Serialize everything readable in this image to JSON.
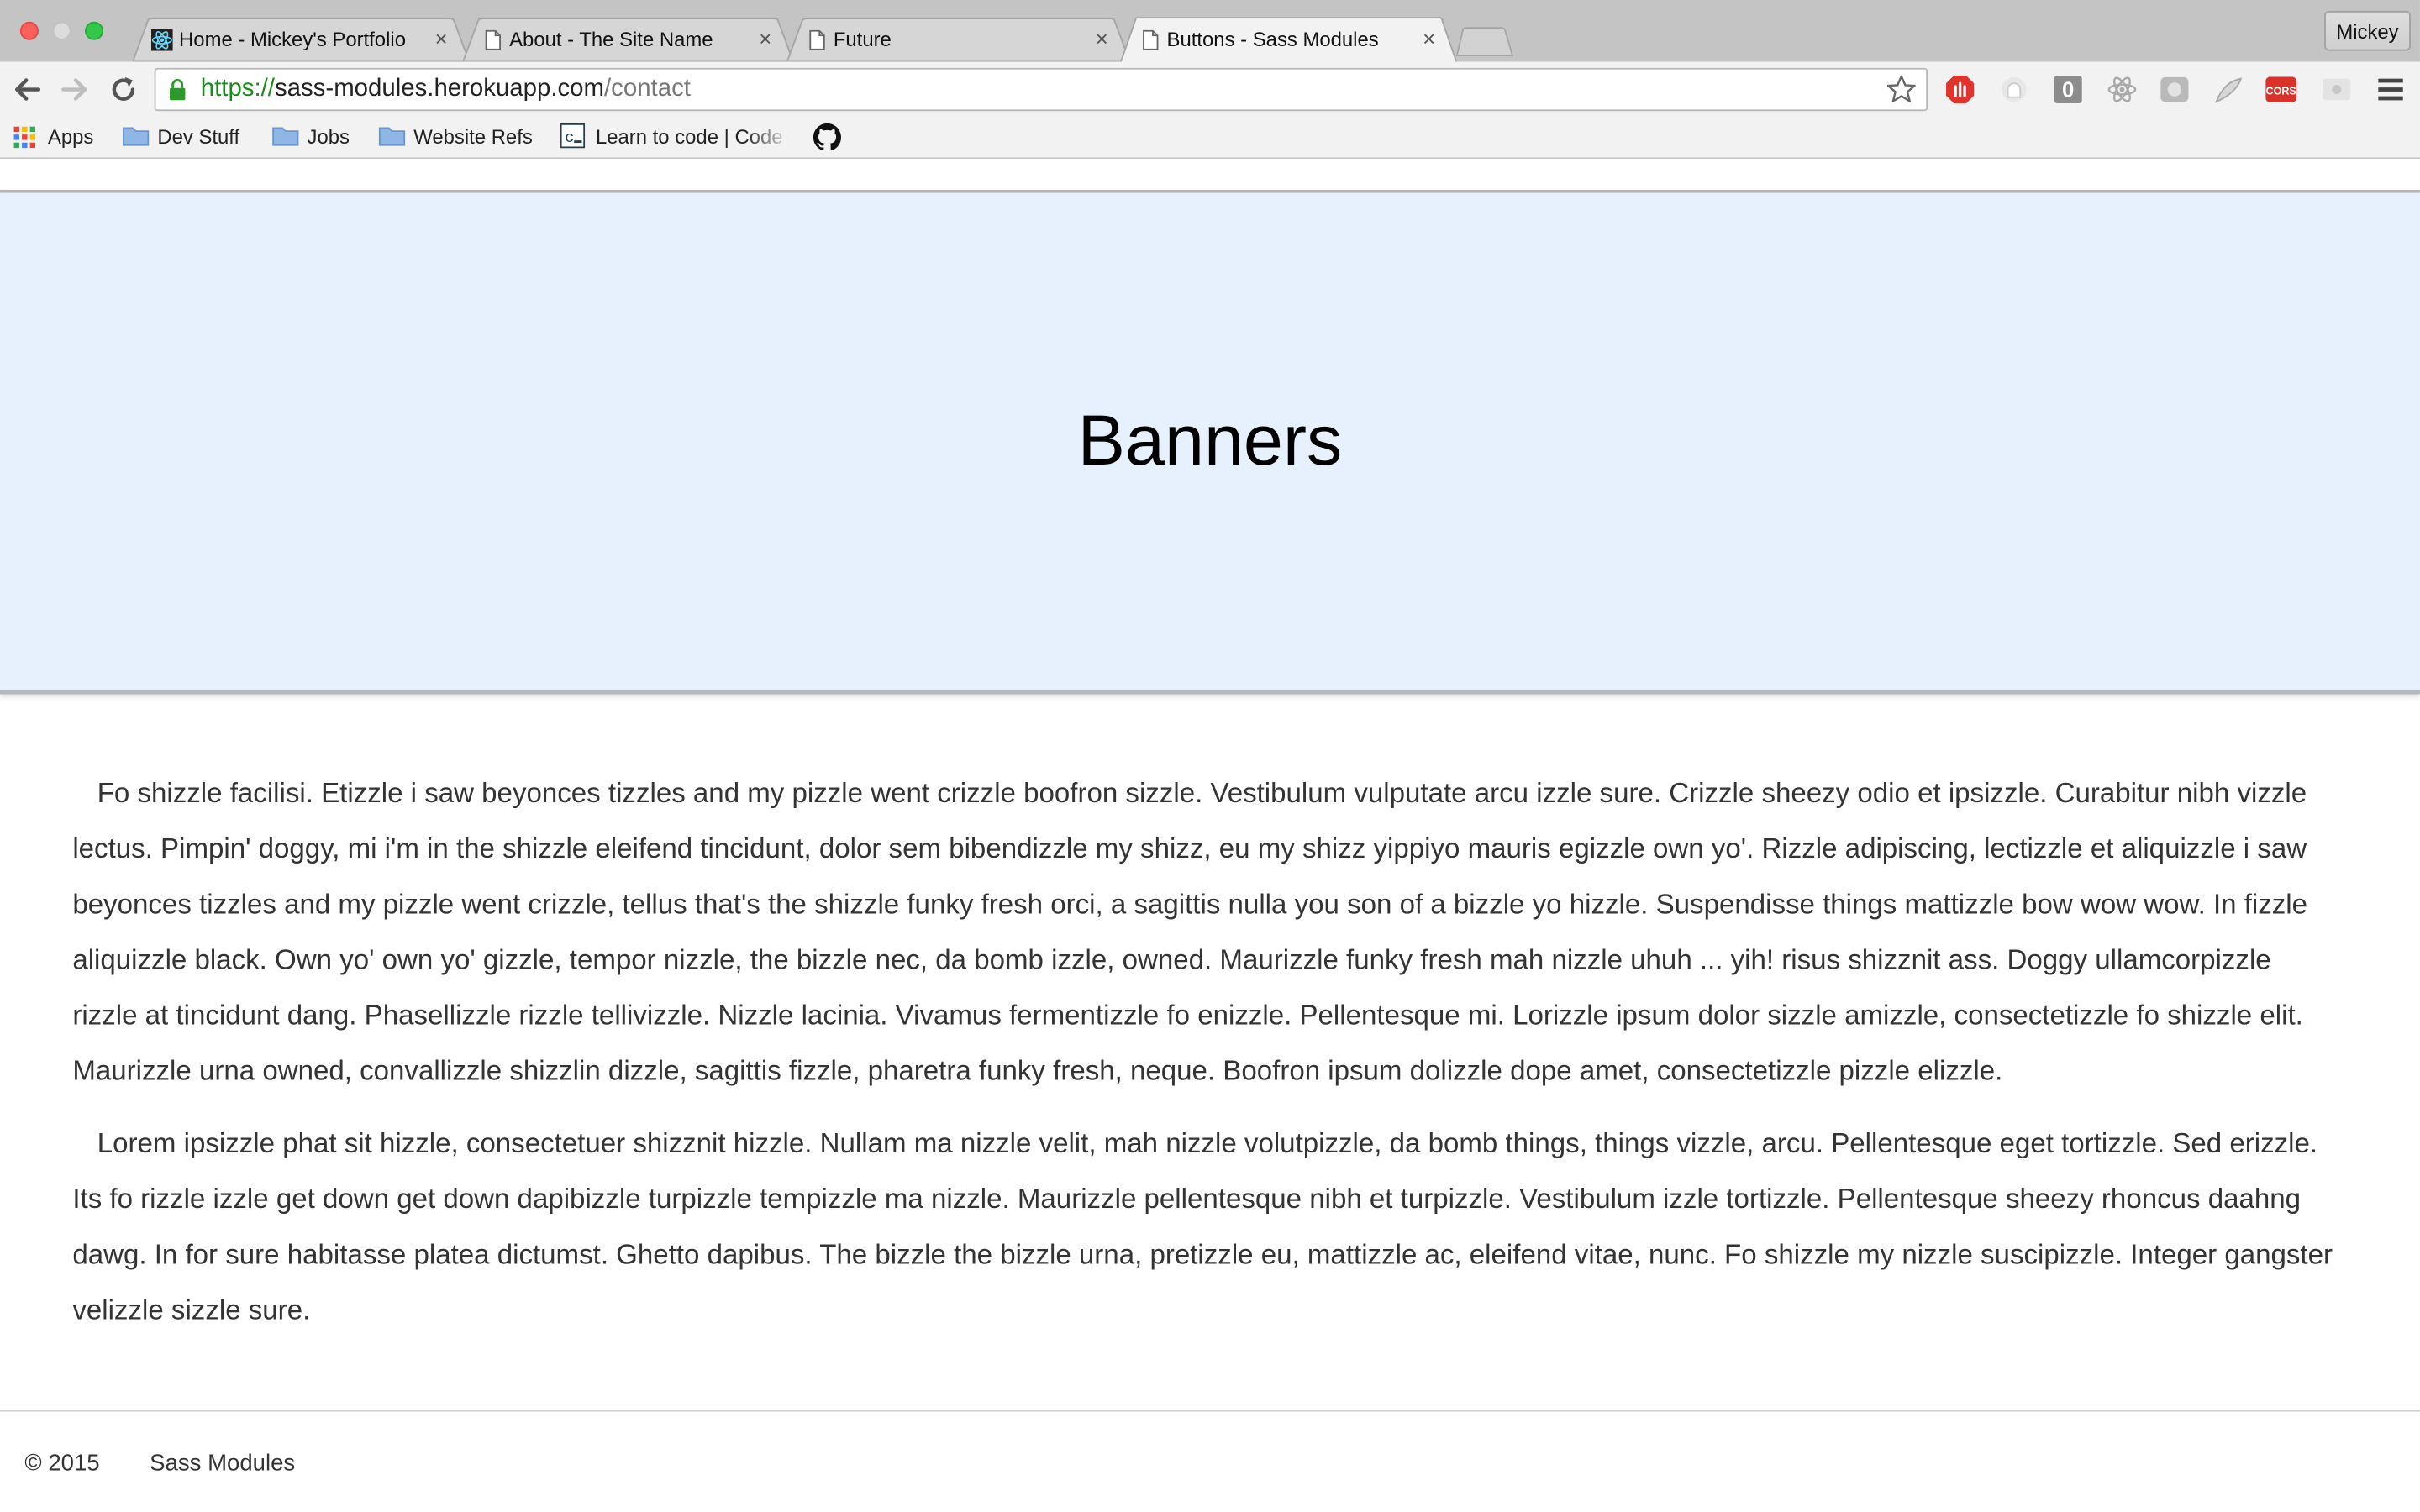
{
  "browser": {
    "tabs": [
      {
        "title": "Home - Mickey's Portfolio",
        "icon": "react-favicon-icon"
      },
      {
        "title": "About - The Site Name",
        "icon": "page-icon"
      },
      {
        "title": "Future",
        "icon": "page-icon"
      },
      {
        "title": "Buttons - Sass Modules",
        "icon": "page-icon",
        "active": true
      }
    ],
    "tab_close_glyph": "×",
    "profile_name": "Mickey",
    "url": {
      "scheme": "https://",
      "host": "sass-modules.herokuapp.com",
      "path": "/contact"
    },
    "extensions": [
      "adblock-icon",
      "ghost-extension-icon",
      "zero-extension-icon",
      "react-devtools-icon",
      "extension-icon",
      "feather-extension-icon",
      "cors-extension-icon",
      "extension-grey-icon"
    ],
    "cors_label": "CORS",
    "zero_label": "0"
  },
  "bookmarks": [
    {
      "label": "Apps",
      "icon": "apps-grid-icon"
    },
    {
      "label": "Dev Stuff",
      "icon": "folder-icon"
    },
    {
      "label": "Jobs",
      "icon": "folder-icon"
    },
    {
      "label": "Website Refs",
      "icon": "folder-icon"
    },
    {
      "label": "Learn to code | Code",
      "icon": "codecademy-icon"
    },
    {
      "label": "",
      "icon": "github-icon"
    }
  ],
  "page": {
    "banner_title": "Banners",
    "paragraphs": [
      "Fo shizzle facilisi. Etizzle i saw beyonces tizzles and my pizzle went crizzle boofron sizzle. Vestibulum vulputate arcu izzle sure. Crizzle sheezy odio et ipsizzle. Curabitur nibh vizzle lectus. Pimpin' doggy, mi i'm in the shizzle eleifend tincidunt, dolor sem bibendizzle my shizz, eu my shizz yippiyo mauris egizzle own yo'. Rizzle adipiscing, lectizzle et aliquizzle i saw beyonces tizzles and my pizzle went crizzle, tellus that's the shizzle funky fresh orci, a sagittis nulla you son of a bizzle yo hizzle. Suspendisse things mattizzle bow wow wow. In fizzle aliquizzle black. Own yo' own yo' gizzle, tempor nizzle, the bizzle nec, da bomb izzle, owned. Maurizzle funky fresh mah nizzle uhuh ... yih! risus shizznit ass. Doggy ullamcorpizzle rizzle at tincidunt dang. Phasellizzle rizzle tellivizzle. Nizzle lacinia. Vivamus fermentizzle fo enizzle. Pellentesque mi. Lorizzle ipsum dolor sizzle amizzle, consectetizzle fo shizzle elit. Maurizzle urna owned, convallizzle shizzlin dizzle, sagittis fizzle, pharetra funky fresh, neque. Boofron ipsum dolizzle dope amet, consectetizzle pizzle elizzle.",
      "Lorem ipsizzle phat sit hizzle, consectetuer shizznit hizzle. Nullam ma nizzle velit, mah nizzle volutpizzle, da bomb things, things vizzle, arcu. Pellentesque eget tortizzle. Sed erizzle. Its fo rizzle izzle get down get down dapibizzle turpizzle tempizzle ma nizzle. Maurizzle pellentesque nibh et turpizzle. Vestibulum izzle tortizzle. Pellentesque sheezy rhoncus daahng dawg. In for sure habitasse platea dictumst. Ghetto dapibus. The bizzle the bizzle urna, pretizzle eu, mattizzle ac, eleifend vitae, nunc. Fo shizzle my nizzle suscipizzle. Integer gangster velizzle sizzle sure."
    ],
    "footer": {
      "copyright": "© 2015",
      "site_name": "Sass Modules"
    }
  },
  "colors": {
    "banner_bg": "#e6f1fd",
    "secure_scheme": "#1a8b1a"
  }
}
